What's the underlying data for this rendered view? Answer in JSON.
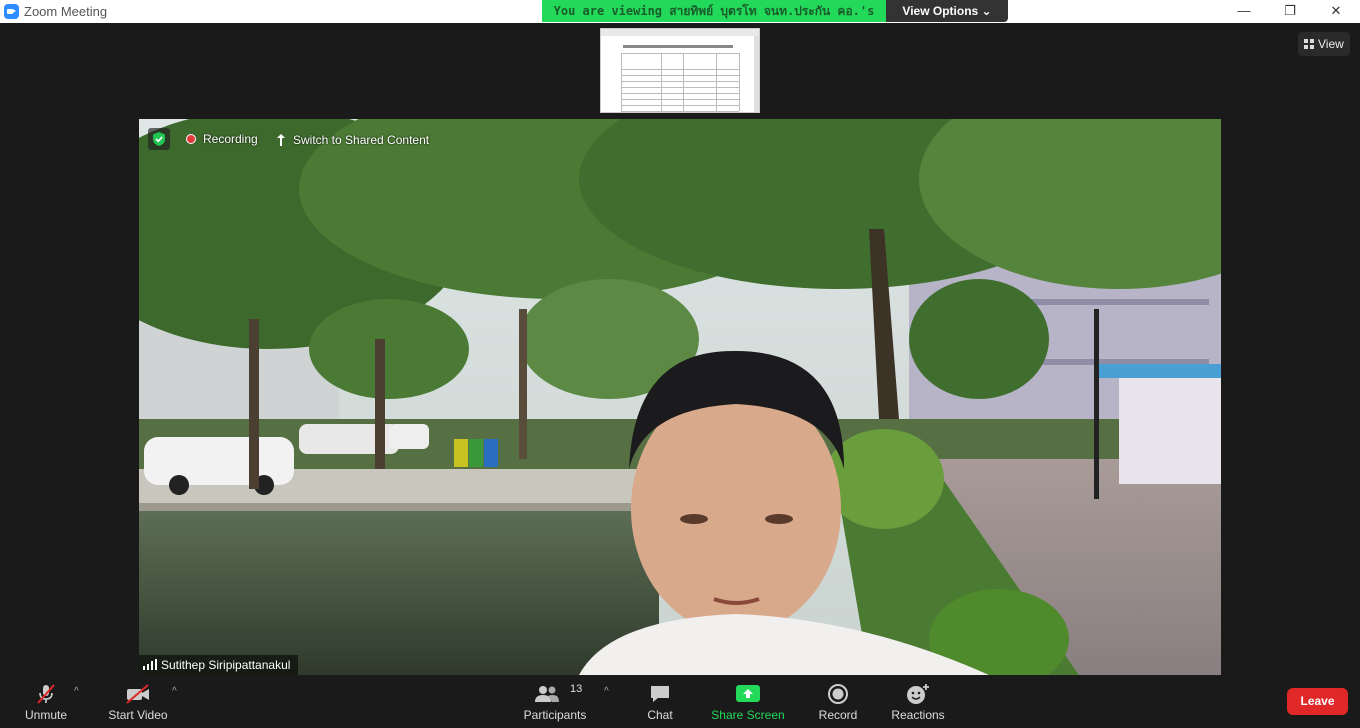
{
  "window": {
    "title": "Zoom Meeting",
    "minimize_glyph": "—",
    "restore_glyph": "❐",
    "close_glyph": "✕"
  },
  "banner": {
    "viewing_text": "You are viewing สายทิพย์ บุตรโท จนท.ประกัน คอ.'s screen",
    "view_options_label": "View Options ⌄"
  },
  "view_button": {
    "label": "View"
  },
  "video": {
    "recording_label": "Recording",
    "switch_label": "Switch to Shared Content",
    "participant_name": "Sutithep Siripipattanakul"
  },
  "toolbar": {
    "unmute_label": "Unmute",
    "start_video_label": "Start Video",
    "participants_label": "Participants",
    "participants_count": "13",
    "chat_label": "Chat",
    "share_screen_label": "Share Screen",
    "record_label": "Record",
    "reactions_label": "Reactions",
    "leave_label": "Leave",
    "caret_glyph": "^"
  },
  "colors": {
    "banner_green": "#23d959",
    "share_green": "#23d959",
    "leave_red": "#e02828",
    "muted_red": "#e02828"
  },
  "icons": [
    "zoom-app-icon",
    "grid-icon",
    "shield-icon",
    "record-dot-icon",
    "switch-icon",
    "signal-icon",
    "mic-muted-icon",
    "video-muted-icon",
    "participants-icon",
    "chat-icon",
    "share-screen-icon",
    "record-icon",
    "reactions-icon"
  ]
}
